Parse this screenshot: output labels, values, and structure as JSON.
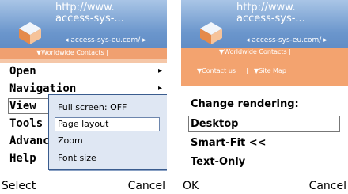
{
  "left_screen": {
    "url_line1": "http://www.",
    "url_line2": "access-sys-...",
    "url_sub": "◂ access-sys-eu.com/ ▸",
    "band_text": "▼Worldwide Contacts  |",
    "menu": [
      {
        "label": "Open",
        "has_submenu": true
      },
      {
        "label": "Navigation",
        "has_submenu": true
      },
      {
        "label": "View",
        "has_submenu": false
      },
      {
        "label": "Tools",
        "has_submenu": false
      },
      {
        "label": "Advanced",
        "has_submenu": false
      },
      {
        "label": "Help",
        "has_submenu": false
      }
    ],
    "submenu": {
      "items": [
        "Full screen: OFF",
        "Page layout",
        "Zoom",
        "Font size"
      ],
      "selected": "Page layout"
    },
    "softkeys": {
      "left": "Select",
      "right": "Cancel"
    }
  },
  "right_screen": {
    "url_line1": "http://www.",
    "url_line2": "access-sys-...",
    "url_sub": "◂ access-sys-eu.com/ ▸",
    "band_text": "▼Worldwide Contacts  |",
    "band_contact": "▼Contact us",
    "band_sitemap": "▼Site Map",
    "title": "Change rendering:",
    "options": [
      "Desktop",
      "Smart-Fit <<",
      "Text-Only"
    ],
    "selected": "Desktop",
    "softkeys": {
      "left": "OK",
      "right": "Cancel"
    }
  },
  "colors": {
    "header_blue": "#6b96cc",
    "band_orange": "#f3a36f",
    "submenu_bg": "#dfe7f3"
  },
  "icons": [
    "browser-logo-icon",
    "submenu-arrow-icon"
  ]
}
